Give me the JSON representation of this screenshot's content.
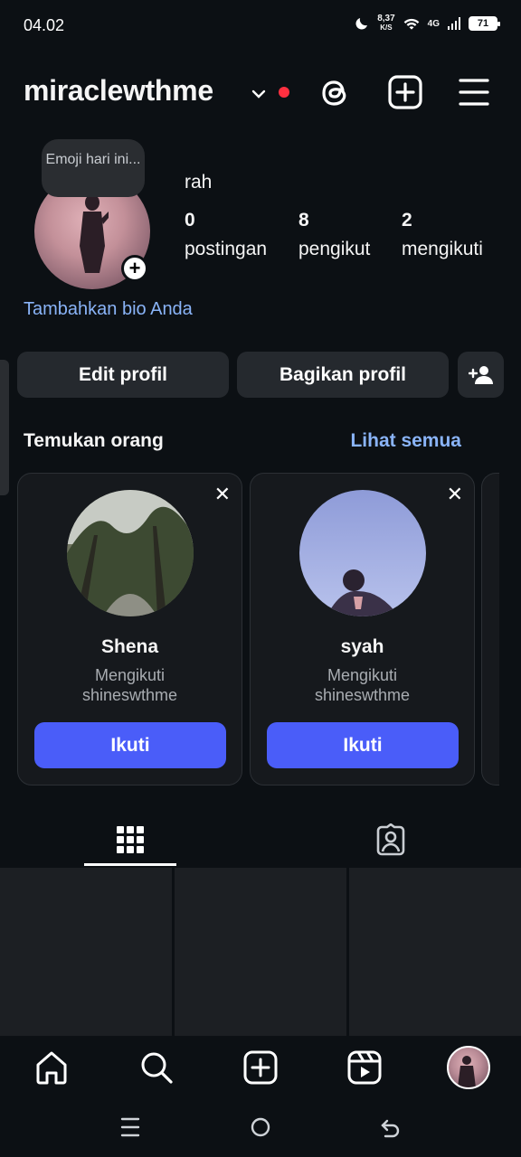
{
  "status_bar": {
    "time": "04.02",
    "net_speed_value": "8,37",
    "net_speed_unit": "K/S",
    "network": "4G",
    "battery": "71"
  },
  "header": {
    "username": "miraclewthme",
    "icons": [
      "chevron-down-icon",
      "threads-icon",
      "create-post-icon",
      "menu-icon"
    ],
    "notification_dot_color": "#ff3040"
  },
  "profile": {
    "emoji_note": "Emoji hari ini...",
    "display_name": "rah",
    "stats": [
      {
        "value": "0",
        "label": "postingan"
      },
      {
        "value": "8",
        "label": "pengikut"
      },
      {
        "value": "2",
        "label": "mengikuti"
      }
    ],
    "bio_prompt": "Tambahkan bio Anda"
  },
  "actions": {
    "edit_profile": "Edit profil",
    "share_profile": "Bagikan profil"
  },
  "discover": {
    "title": "Temukan orang",
    "see_all": "Lihat semua",
    "cards": [
      {
        "name": "Shena",
        "subtitle_line1": "Mengikuti",
        "subtitle_line2": "shineswthme",
        "follow_label": "Ikuti"
      },
      {
        "name": "syah",
        "subtitle_line1": "Mengikuti",
        "subtitle_line2": "shineswthme",
        "follow_label": "Ikuti"
      }
    ]
  },
  "tabs": [
    "grid-icon",
    "tagged-icon"
  ],
  "bottom_nav": [
    "home-icon",
    "search-icon",
    "create-icon",
    "reels-icon",
    "profile-avatar"
  ],
  "colors": {
    "background": "#0c1014",
    "accent_blue": "#4a5df9",
    "link_blue": "#8ab4f8",
    "button_bg": "#25292e"
  }
}
